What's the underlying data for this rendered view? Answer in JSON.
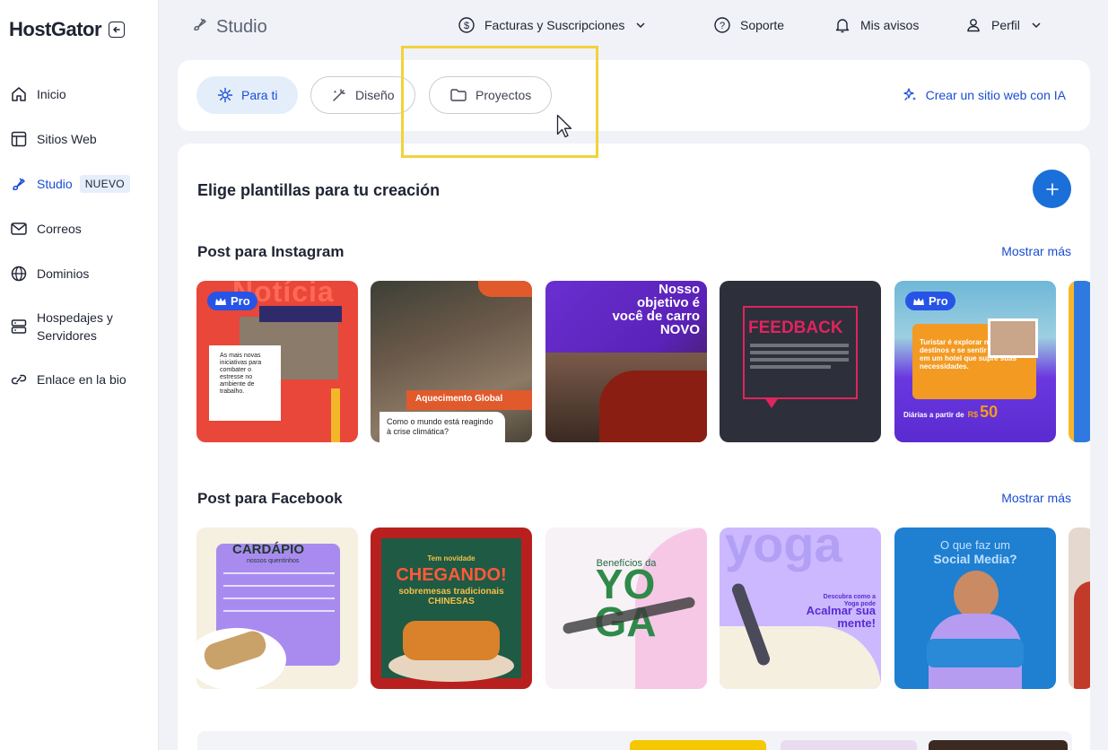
{
  "brand": {
    "name": "HostGator"
  },
  "sidebar": {
    "items": [
      {
        "label": "Inicio",
        "icon": "home-icon"
      },
      {
        "label": "Sitios Web",
        "icon": "layout-icon"
      },
      {
        "label": "Studio",
        "icon": "brush-icon",
        "badge": "NUEVO"
      },
      {
        "label": "Correos",
        "icon": "mail-icon"
      },
      {
        "label": "Dominios",
        "icon": "globe-icon"
      },
      {
        "label": "Hospedajes y Servidores",
        "icon": "server-icon"
      },
      {
        "label": "Enlace en la bio",
        "icon": "link-icon"
      }
    ]
  },
  "topbar": {
    "title": "Studio",
    "billing": "Facturas y Suscripciones",
    "support": "Soporte",
    "notices": "Mis avisos",
    "profile": "Perfil"
  },
  "filters": {
    "tabs": [
      {
        "label": "Para ti",
        "icon": "sparkle-icon"
      },
      {
        "label": "Diseño",
        "icon": "magic-wand-icon"
      },
      {
        "label": "Proyectos",
        "icon": "folder-icon"
      }
    ],
    "ai_link": "Crear un sitio web con IA"
  },
  "main": {
    "title": "Elige plantillas para tu creación",
    "sections": [
      {
        "title": "Post para Instagram",
        "show_more": "Mostrar más",
        "tiles": [
          {
            "pro": "Pro",
            "headline": "Notícia",
            "body": "As mais novas iniciativas para combater o estresse no ambiente de trabalho.",
            "color": "#e8473a"
          },
          {
            "headline": "Aquecimento Global",
            "body": "Como o mundo está reagindo à crise climática?",
            "color": "#6b5a4a"
          },
          {
            "headline": "Nosso objetivo é você de carro NOVO",
            "color": "#6a2fd1"
          },
          {
            "headline": "FEEDBACK",
            "color": "#2d2f3a"
          },
          {
            "pro": "Pro",
            "headline": "Turistar é explorar novos destinos e se sentir em casa em um hotel que supre suas necessidades.",
            "price_label": "Diárias a partir de",
            "price_currency": "R$",
            "price": "50",
            "color": "#6b37e0"
          }
        ]
      },
      {
        "title": "Post para Facebook",
        "show_more": "Mostrar más",
        "tiles": [
          {
            "headline": "CARDÁPIO",
            "sub": "nossos quentinhos",
            "color": "#f6f0e0"
          },
          {
            "kicker": "Tem novidade",
            "headline": "CHEGANDO!",
            "sub": "sobremesas tradicionais CHINESAS",
            "color": "#b82020"
          },
          {
            "kicker": "Benefícios da",
            "headline": "YOGA",
            "color": "#f6dcef"
          },
          {
            "headline": "yoga",
            "sub": "Descubra como a Yoga pode",
            "cta": "Acalmar sua mente!",
            "color": "#cbb8ff"
          },
          {
            "kicker": "O que faz um",
            "headline": "Social Media?",
            "color": "#1f7fd0"
          }
        ]
      }
    ]
  },
  "colors": {
    "accent": "#1a4dd4",
    "add_button": "#1a6fd8",
    "highlight": "#f0d33c"
  }
}
